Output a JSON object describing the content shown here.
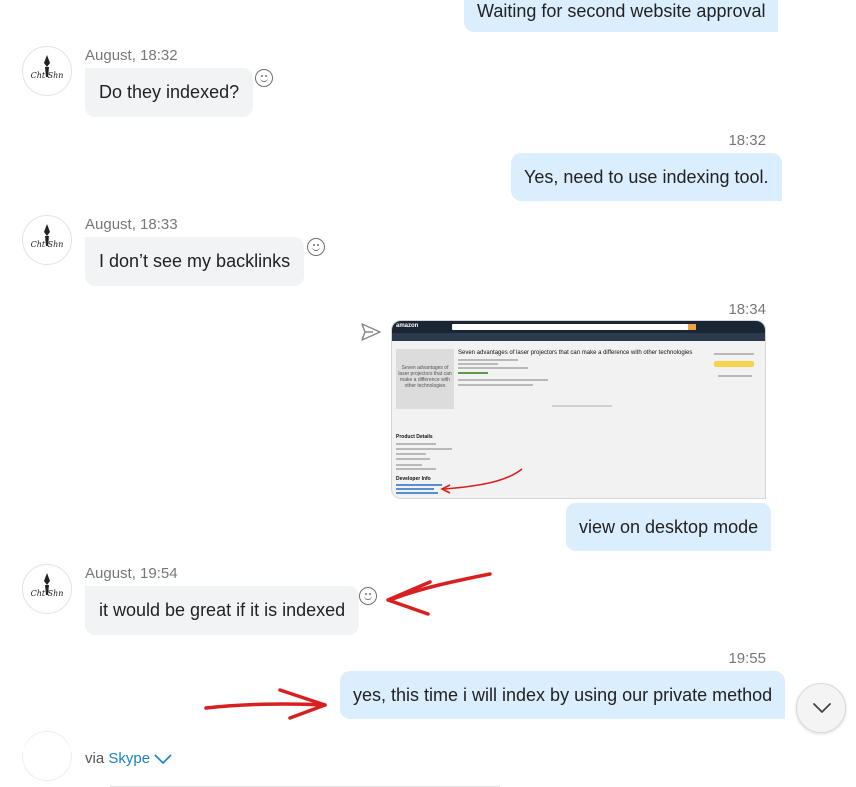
{
  "messages": [
    {
      "id": "m1",
      "dir": "out",
      "text": "Waiting for second website approval"
    },
    {
      "id": "m2",
      "dir": "in",
      "meta": "August, 18:32",
      "text": "Do they indexed?"
    },
    {
      "id": "m3",
      "dir": "out",
      "time": "18:32",
      "text": "Yes, need to use indexing tool."
    },
    {
      "id": "m4",
      "dir": "in",
      "meta": "August, 18:33",
      "text": "I don’t see my backlinks"
    },
    {
      "id": "m5",
      "dir": "out",
      "time": "18:34",
      "type": "image"
    },
    {
      "id": "m6",
      "dir": "out",
      "text": "view on desktop mode"
    },
    {
      "id": "m7",
      "dir": "in",
      "meta": "August, 19:54",
      "text": "it would be great if it is indexed"
    },
    {
      "id": "m8",
      "dir": "out",
      "time": "19:55",
      "text": "yes, this time i will index by using our private method"
    }
  ],
  "screenshot": {
    "logo": "amazon",
    "cover_text": "Seven advantages of laser projectors that can make a difference with other technologies",
    "title": "Seven advantages of laser projectors that can make a difference with other technologies",
    "product_details_heading": "Product Details",
    "developer_info_heading": "Developer Info"
  },
  "footer": {
    "via_prefix": "via ",
    "via_app": "Skype"
  },
  "icons": {
    "emoji": "smiley-icon",
    "send": "send-icon",
    "scroll": "chevron-down-icon",
    "skype_chevron": "chevron-down-icon"
  },
  "colors": {
    "outgoing_bubble": "#daeefd",
    "incoming_bubble": "#f1f3f5",
    "skype_blue": "#1a80c8",
    "annotation_red": "#d92020"
  }
}
